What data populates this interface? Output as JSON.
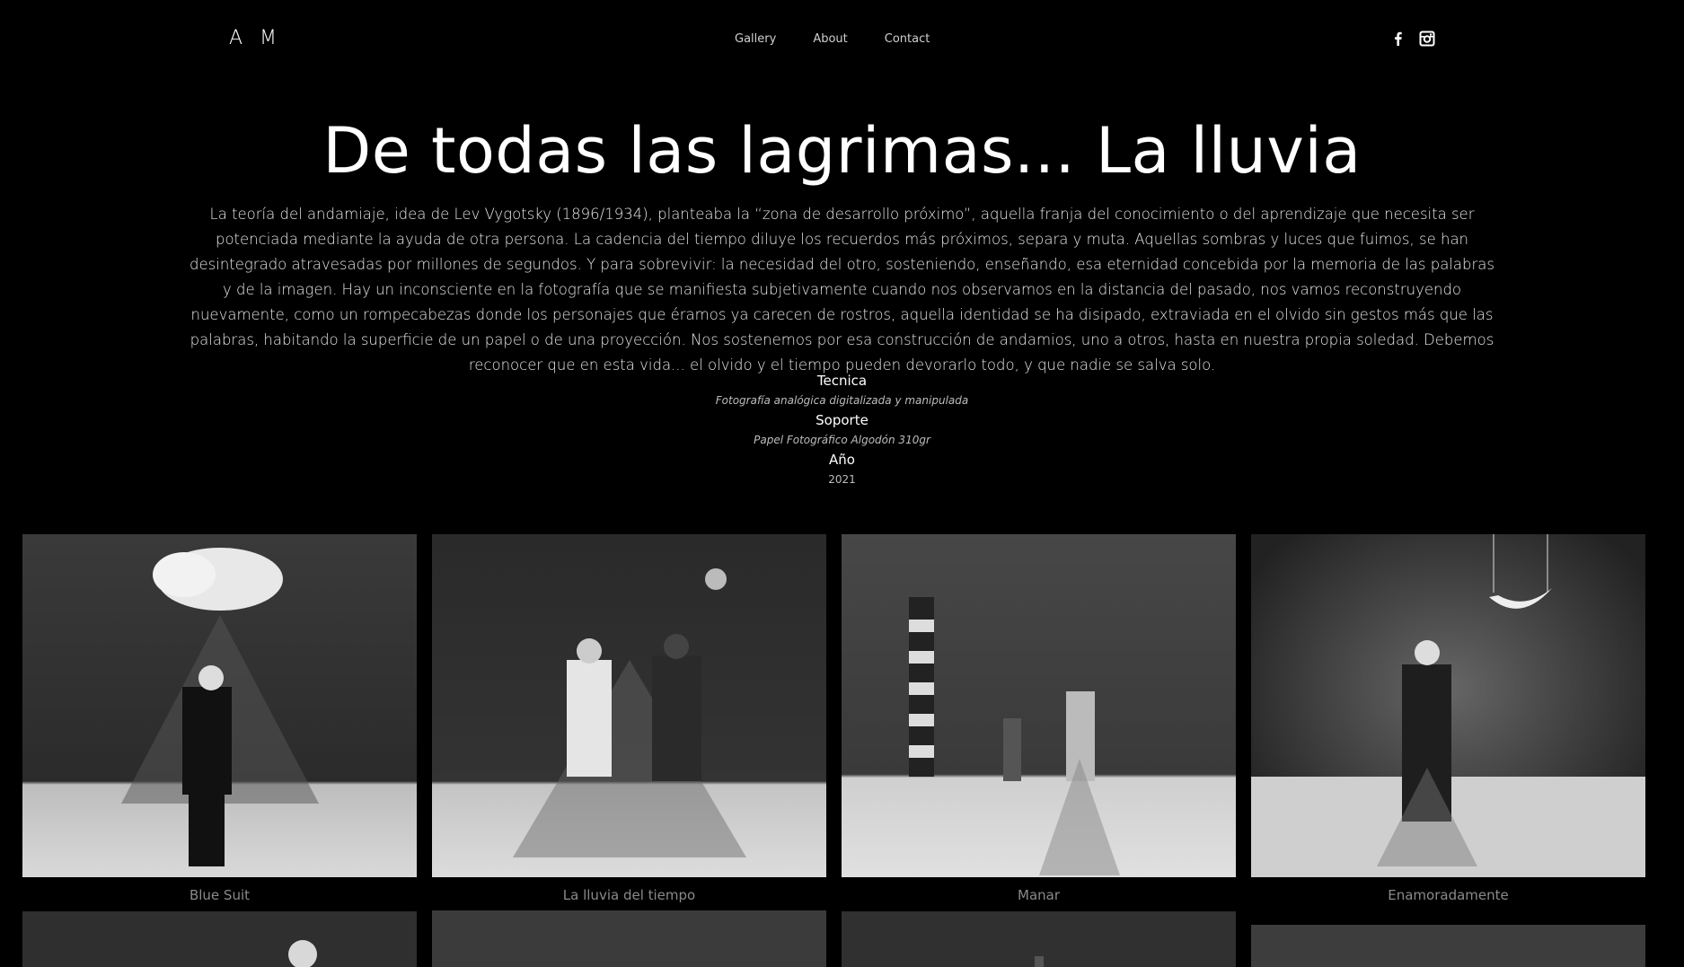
{
  "header": {
    "logo": "A M",
    "nav": [
      "Gallery",
      "About",
      "Contact"
    ]
  },
  "social": [
    "facebook-icon",
    "instagram-icon"
  ],
  "page": {
    "title": "De todas las lagrimas... La lluvia",
    "description": "La teoría del andamiaje, idea de Lev Vygotsky (1896/1934), planteaba la “zona de desarrollo próximo”, aquella franja del conocimiento o del aprendizaje que necesita ser potenciada mediante la ayuda de otra persona. La cadencia del tiempo diluye los recuerdos más próximos, separa y muta. Aquellas sombras y luces que fuimos, se han desintegrado atravesadas por millones de segundos. Y para sobrevivir: la necesidad del otro, sosteniendo, enseñando, esa eternidad concebida por la memoria de las palabras y de la imagen. Hay un inconsciente en la fotografía que se manifiesta subjetivamente cuando nos observamos en la distancia del pasado, nos vamos reconstruyendo nuevamente, como un rompecabezas donde los personajes que éramos ya carecen de rostros, aquella identidad se ha disipado, extraviada en el olvido sin gestos más que las palabras, habitando la superficie de un papel o de una proyección. Nos sostenemos por esa construcción de andamios, uno a otros, hasta en nuestra propia soledad. Debemos reconocer que en esta vida... el olvido y el tiempo pueden devorarlo todo, y que nadie se salva solo."
  },
  "specs": {
    "tecnica_label": "Tecnica",
    "tecnica_value": "Fotografía analógica digitalizada y manipulada",
    "soporte_label": "Soporte",
    "soporte_value": "Papel Fotográfico Algodón 310gr",
    "anio_label": "Año",
    "anio_value": "2021"
  },
  "gallery": {
    "captions": [
      "Blue Suit",
      "La lluvia del tiempo",
      "Manar",
      "Enamoradamente"
    ]
  },
  "colors": {
    "background": "#000000",
    "caption": "#8a8a8a"
  }
}
